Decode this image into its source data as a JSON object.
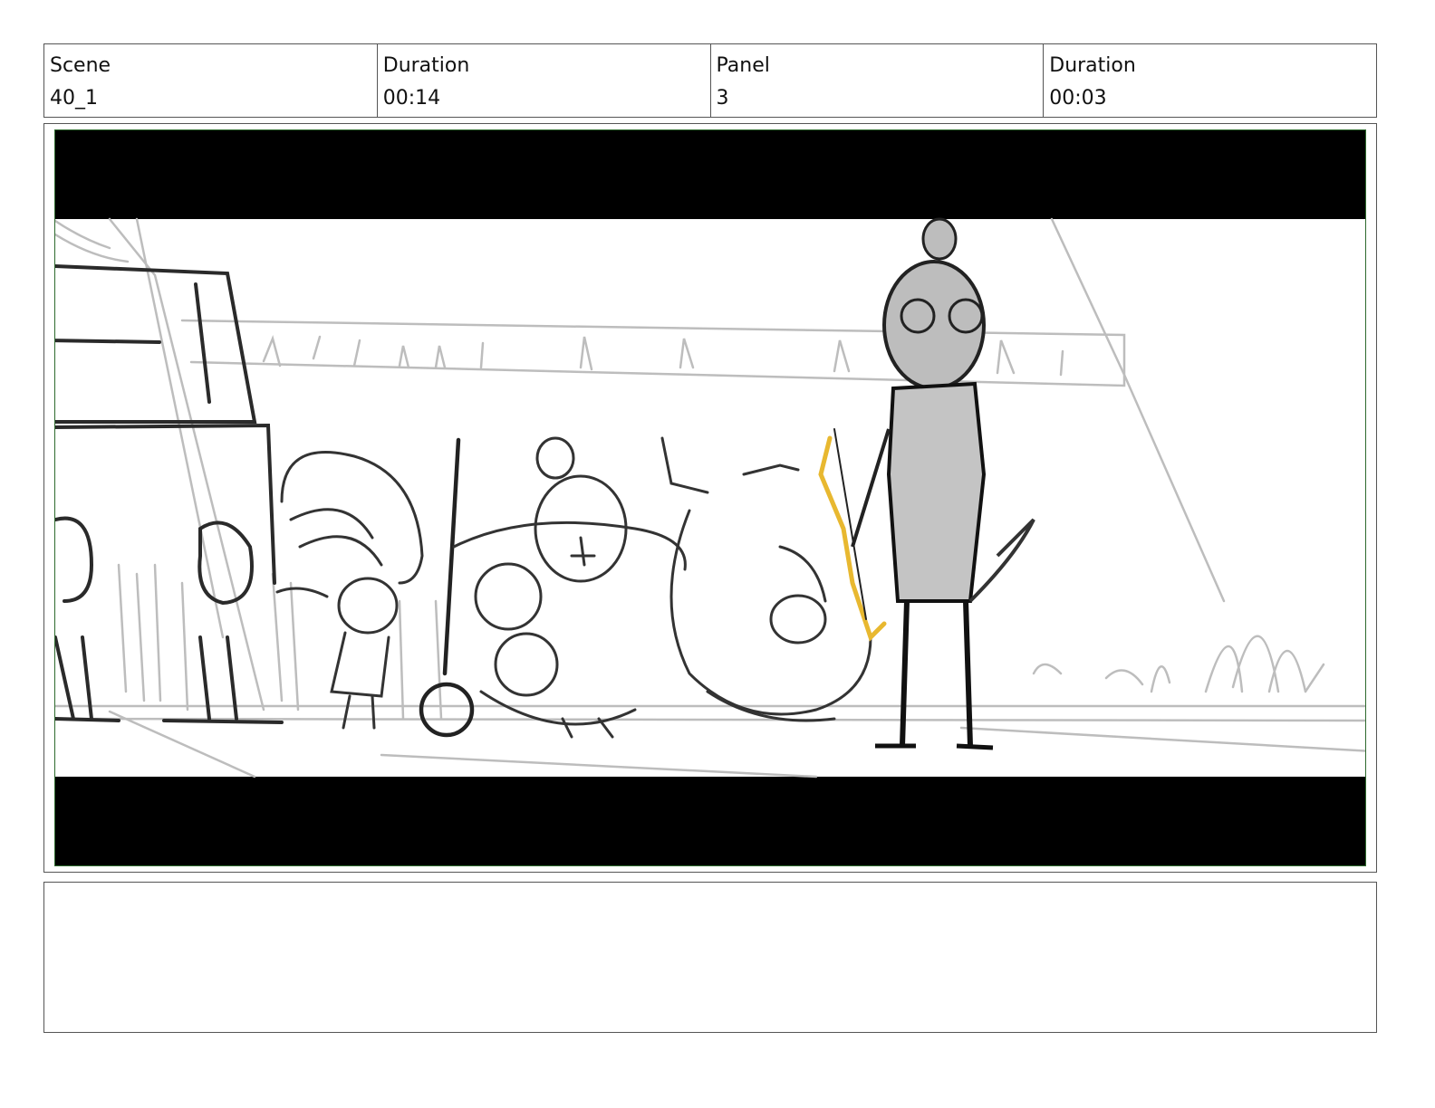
{
  "header": {
    "scene_label": "Scene",
    "scene_value": "40_1",
    "scene_duration_label": "Duration",
    "scene_duration_value": "00:14",
    "panel_label": "Panel",
    "panel_value": "3",
    "panel_duration_label": "Duration",
    "panel_duration_value": "00:03"
  },
  "colors": {
    "frame_border": "#2f6b2f",
    "letterbox": "#000000",
    "bow_highlight": "#e8b830",
    "sketch_light": "#bdbdbd",
    "sketch_dark": "#222222"
  },
  "notes": {
    "text": ""
  }
}
